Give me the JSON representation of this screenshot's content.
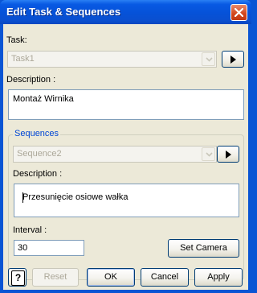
{
  "window": {
    "title": "Edit Task & Sequences"
  },
  "task": {
    "label": "Task:",
    "selected": "Task1",
    "description_label": "Description :",
    "description": "Montaż Wirnika"
  },
  "sequences": {
    "group_label": "Sequences",
    "selected": "Sequence2",
    "description_label": "Description :",
    "description": "Przesunięcie osiowe wałka"
  },
  "interval": {
    "label": "Interval :",
    "value": "30"
  },
  "buttons": {
    "set_camera": "Set Camera",
    "help": "?",
    "reset": "Reset",
    "ok": "OK",
    "cancel": "Cancel",
    "apply": "Apply"
  },
  "icons": {
    "close": "close-icon",
    "dropdown": "chevron-down-icon",
    "play": "play-icon",
    "help": "help-icon"
  }
}
